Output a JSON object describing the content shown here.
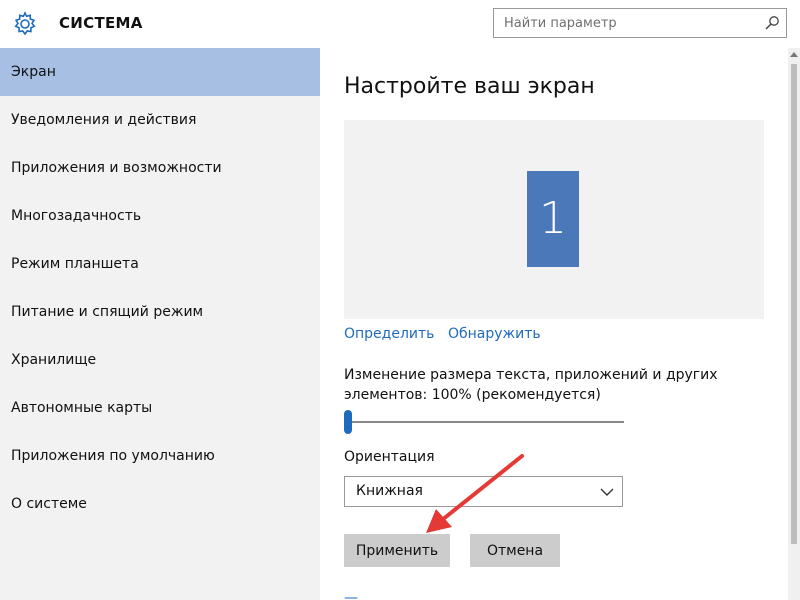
{
  "app": {
    "name": "Windows 10 Settings",
    "title": "СИСТЕМА",
    "icons": {
      "gear": "gear-icon",
      "search": "search-icon",
      "chevron": "chevron-down-icon"
    }
  },
  "search": {
    "placeholder": "Найти параметр",
    "value": ""
  },
  "sidebar": {
    "items": [
      {
        "label": "Экран",
        "selected": true
      },
      {
        "label": "Уведомления и действия",
        "selected": false
      },
      {
        "label": "Приложения и возможности",
        "selected": false
      },
      {
        "label": "Многозадачность",
        "selected": false
      },
      {
        "label": "Режим планшета",
        "selected": false
      },
      {
        "label": "Питание и спящий режим",
        "selected": false
      },
      {
        "label": "Хранилище",
        "selected": false
      },
      {
        "label": "Автономные карты",
        "selected": false
      },
      {
        "label": "Приложения по умолчанию",
        "selected": false
      },
      {
        "label": "О системе",
        "selected": false
      }
    ]
  },
  "main": {
    "title": "Настройте ваш экран",
    "display": {
      "monitor_number": "1"
    },
    "links": {
      "identify": "Определить",
      "detect": "Обнаружить"
    },
    "scale": {
      "label": "Изменение размера текста, приложений и других элементов: 100% (рекомендуется)",
      "value_percent": 100,
      "slider_position": 0
    },
    "orientation": {
      "label": "Ориентация",
      "selected": "Книжная"
    },
    "buttons": {
      "apply": "Применить",
      "cancel": "Отмена"
    }
  },
  "colors": {
    "accent": "#1e6bbd",
    "selected_nav": "#a8bfe4",
    "monitor_tile": "#4a78b8",
    "sidebar_bg": "#f2f2f2",
    "button_bg": "#cccccc",
    "annotation_arrow": "#e53935"
  }
}
